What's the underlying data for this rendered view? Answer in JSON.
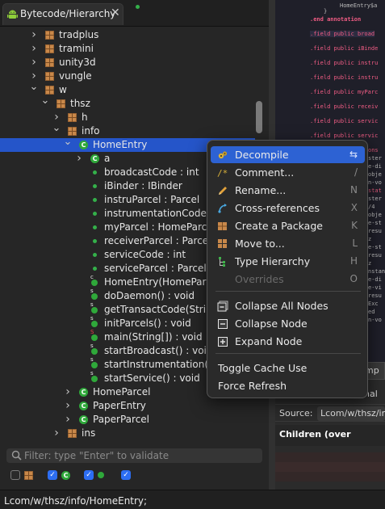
{
  "tab": {
    "title": "Bytecode/Hierarchy",
    "close": "✕"
  },
  "tree": [
    {
      "label": "tradplus",
      "icon": "package-icon",
      "indent": 1,
      "chev": "right"
    },
    {
      "label": "tramini",
      "icon": "package-icon",
      "indent": 1,
      "chev": "right"
    },
    {
      "label": "unity3d",
      "icon": "package-icon",
      "indent": 1,
      "chev": "right"
    },
    {
      "label": "vungle",
      "icon": "package-icon",
      "indent": 1,
      "chev": "right"
    },
    {
      "label": "w",
      "icon": "package-icon",
      "indent": 1,
      "chev": "down"
    },
    {
      "label": "thsz",
      "icon": "package-icon",
      "indent": 2,
      "chev": "down"
    },
    {
      "label": "h",
      "icon": "package-icon",
      "indent": 3,
      "chev": "right"
    },
    {
      "label": "info",
      "icon": "package-icon",
      "indent": 3,
      "chev": "down"
    },
    {
      "label": "HomeEntry",
      "icon": "class-icon",
      "indent": 4,
      "chev": "down",
      "selected": true
    },
    {
      "label": "a",
      "icon": "class-icon",
      "indent": 5,
      "chev": "right"
    },
    {
      "label": "broadcastCode : int",
      "icon": "field-icon",
      "indent": 5
    },
    {
      "label": "iBinder : IBinder",
      "icon": "field-icon",
      "indent": 5
    },
    {
      "label": "instruParcel : Parcel",
      "icon": "field-icon",
      "indent": 5
    },
    {
      "label": "instrumentationCode : int",
      "icon": "field-icon",
      "indent": 5
    },
    {
      "label": "myParcel : HomeParcel",
      "icon": "field-icon",
      "indent": 5
    },
    {
      "label": "receiverParcel : Parcel",
      "icon": "field-icon",
      "indent": 5
    },
    {
      "label": "serviceCode : int",
      "icon": "field-icon",
      "indent": 5
    },
    {
      "label": "serviceParcel : Parcel",
      "icon": "field-icon",
      "indent": 5
    },
    {
      "label": "HomeEntry(HomeParcel)",
      "icon": "constructor-icon",
      "indent": 5
    },
    {
      "label": "doDaemon() : void",
      "icon": "method-icon",
      "indent": 5
    },
    {
      "label": "getTransactCode(String,",
      "icon": "method-icon",
      "indent": 5
    },
    {
      "label": "initParcels() : void",
      "icon": "method-icon",
      "indent": 5
    },
    {
      "label": "main(String[]) : void",
      "icon": "main-method-icon",
      "indent": 5
    },
    {
      "label": "startBroadcast() : void",
      "icon": "method-icon",
      "indent": 5
    },
    {
      "label": "startInstrumentation() : v",
      "icon": "method-icon",
      "indent": 5
    },
    {
      "label": "startService() : void",
      "icon": "method-icon",
      "indent": 5
    },
    {
      "label": "HomeParcel",
      "icon": "class-icon",
      "indent": 4,
      "chev": "right"
    },
    {
      "label": "PaperEntry",
      "icon": "class-icon",
      "indent": 4,
      "chev": "right"
    },
    {
      "label": "PaperParcel",
      "icon": "class-icon",
      "indent": 4,
      "chev": "right"
    },
    {
      "label": "ins",
      "icon": "package-icon",
      "indent": 3,
      "chev": "right"
    }
  ],
  "filter": {
    "placeholder": "Filter: type \"Enter\" to validate"
  },
  "status": {
    "path": "Lcom/w/thsz/info/HomeEntry;"
  },
  "menu": {
    "items": [
      {
        "label": "Decompile",
        "key": "⇆",
        "icon": "decompile-icon",
        "active": true
      },
      {
        "label": "Comment...",
        "key": "/",
        "icon": "comment-icon"
      },
      {
        "label": "Rename...",
        "key": "N",
        "icon": "rename-icon"
      },
      {
        "label": "Cross-references",
        "key": "X",
        "icon": "cross-references-icon"
      },
      {
        "label": "Create a Package",
        "key": "K",
        "icon": "create-package-icon"
      },
      {
        "label": "Move to...",
        "key": "L",
        "icon": "move-to-icon"
      },
      {
        "label": "Type Hierarchy",
        "key": "H",
        "icon": "type-hierarchy-icon"
      },
      {
        "label": "Overrides",
        "key": "O",
        "icon": "overrides-icon",
        "disabled": true
      },
      {
        "label": "Collapse All Nodes",
        "key": "",
        "icon": "collapse-all-icon"
      },
      {
        "label": "Collapse Node",
        "key": "",
        "icon": "collapse-node-icon"
      },
      {
        "label": "Expand Node",
        "key": "",
        "icon": "expand-node-icon"
      },
      {
        "label": "Toggle Cache Use",
        "key": ""
      },
      {
        "label": "Force Refresh",
        "key": ""
      }
    ]
  },
  "code": {
    "lines": [
      {
        "text": "HomeEntry$a",
        "style": "dim"
      },
      {
        "text": "}",
        "style": "dim"
      },
      {
        "text": ".end annotation",
        "style": "kw"
      },
      {
        "text": ".field public broad",
        "style": "field"
      },
      {
        "text": ".field public iBinde",
        "style": "field"
      },
      {
        "text": ".field public instru",
        "style": "field"
      },
      {
        "text": ".field public instru",
        "style": "field"
      },
      {
        "text": ".field public myParc",
        "style": "field"
      },
      {
        "text": ".field public receiv",
        "style": "field"
      },
      {
        "text": ".field public servic",
        "style": "field"
      },
      {
        "text": ".field public servic",
        "style": "field"
      }
    ],
    "frag": [
      "ons",
      "ster",
      "e-di",
      "obje",
      "n-vo",
      "stat",
      "ster",
      "/4",
      "obje",
      "e-st",
      "resu",
      "z",
      "e-st",
      "resu",
      "z",
      "nstan",
      "e-di",
      "e-vi",
      "resu",
      "Exc",
      "ed",
      "n-vo"
    ]
  },
  "right_panel": {
    "tab_mp": "mp",
    "tab_nal": "nal",
    "source_label": "Source:",
    "source_value": "Lcom/w/thsz/in",
    "children_label": "Children (over"
  },
  "colors": {
    "selection": "#2555c9",
    "menu_active": "#2d62d3",
    "accent": "#2d6ef3"
  }
}
